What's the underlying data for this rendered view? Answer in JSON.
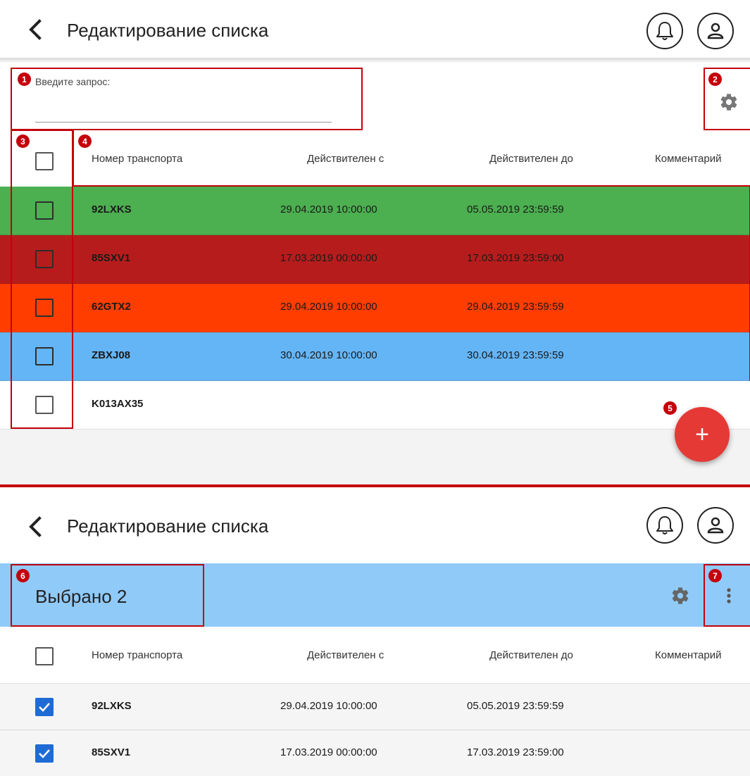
{
  "app": {
    "title": "Редактирование списка"
  },
  "search": {
    "label": "Введите запрос:",
    "value": "",
    "placeholder": ""
  },
  "table": {
    "columns": [
      "Номер транспорта",
      "Действителен с",
      "Действителен до",
      "Комментарий"
    ],
    "rows": [
      {
        "number": "92LXKS",
        "from": "29.04.2019 10:00:00",
        "to": "05.05.2019 23:59:59",
        "comment": "",
        "color": "#4caf50"
      },
      {
        "number": "85SXV1",
        "from": "17.03.2019 00:00:00",
        "to": "17.03.2019 23:59:00",
        "comment": "",
        "color": "#b71c1c"
      },
      {
        "number": "62GTX2",
        "from": "29.04.2019 10:00:00",
        "to": "29.04.2019 23:59:59",
        "comment": "",
        "color": "#ff3d00"
      },
      {
        "number": "ZBXJ08",
        "from": "30.04.2019 10:00:00",
        "to": "30.04.2019 23:59:59",
        "comment": "",
        "color": "#64b5f6"
      },
      {
        "number": "K013AX35",
        "from": "",
        "to": "",
        "comment": "",
        "color": "#ffffff"
      }
    ]
  },
  "fab": {
    "label": "+",
    "icon": "plus-icon"
  },
  "selection": {
    "text": "Выбрано 2",
    "rows": [
      {
        "number": "92LXKS",
        "from": "29.04.2019 10:00:00",
        "to": "05.05.2019 23:59:59",
        "checked": true
      },
      {
        "number": "85SXV1",
        "from": "17.03.2019 00:00:00",
        "to": "17.03.2019 23:59:00",
        "checked": true
      }
    ]
  },
  "annotations": [
    "1",
    "2",
    "3",
    "4",
    "5",
    "6",
    "7"
  ],
  "colors": {
    "annotation": "#c4000b",
    "fab": "#e53935",
    "selection_bar": "#90caf9",
    "checked": "#1e6bd6"
  }
}
